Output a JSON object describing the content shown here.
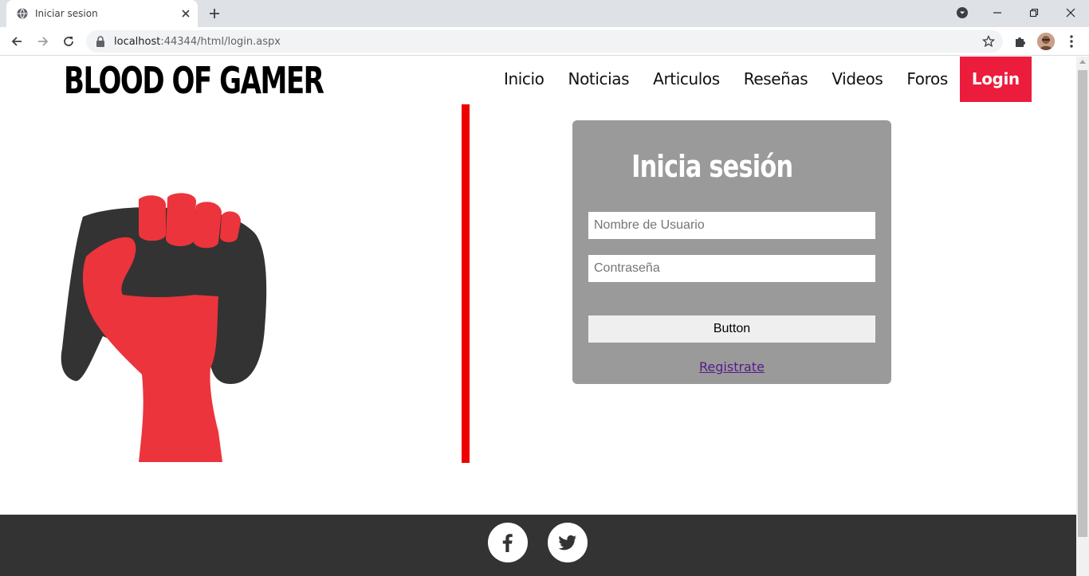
{
  "browser": {
    "tab_title": "Iniciar sesion",
    "url_host": "localhost",
    "url_path": ":44344/html/login.aspx"
  },
  "site": {
    "brand": "BLOOD OF GAMER",
    "nav": [
      "Inicio",
      "Noticias",
      "Articulos",
      "Reseñas",
      "Videos",
      "Foros",
      "Login"
    ],
    "accent_color": "#ec1c3c",
    "divider_color": "#ee0000"
  },
  "login": {
    "heading": "Inicia sesión",
    "username_placeholder": "Nombre de Usuario",
    "password_placeholder": "Contraseña",
    "button_label": "Button",
    "register_link": "Registrate"
  },
  "footer": {
    "social": [
      "facebook-icon",
      "twitter-icon"
    ]
  }
}
